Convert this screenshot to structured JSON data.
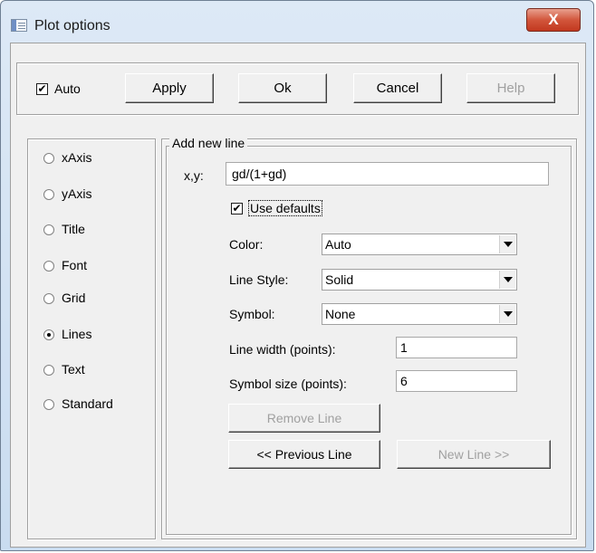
{
  "window": {
    "title": "Plot options",
    "close_glyph": "X"
  },
  "toolbar": {
    "auto_label": "Auto",
    "auto_checked": true,
    "apply_label": "Apply",
    "ok_label": "Ok",
    "cancel_label": "Cancel",
    "help_label": "Help"
  },
  "categories": {
    "items": [
      {
        "label": "xAxis",
        "selected": false
      },
      {
        "label": "yAxis",
        "selected": false
      },
      {
        "label": "Title",
        "selected": false
      },
      {
        "label": "Font",
        "selected": false
      },
      {
        "label": "Grid",
        "selected": false
      },
      {
        "label": "Lines",
        "selected": true
      },
      {
        "label": "Text",
        "selected": false
      },
      {
        "label": "Standard",
        "selected": false
      }
    ]
  },
  "line_panel": {
    "group_title": "Add new line",
    "xy_label": "x,y:",
    "xy_value": "gd/(1+gd)",
    "use_defaults_label": "Use defaults",
    "use_defaults_checked": true,
    "color_label": "Color:",
    "color_value": "Auto",
    "line_style_label": "Line Style:",
    "line_style_value": "Solid",
    "symbol_label": "Symbol:",
    "symbol_value": "None",
    "line_width_label": "Line width (points):",
    "line_width_value": "1",
    "symbol_size_label": "Symbol size (points):",
    "symbol_size_value": "6",
    "remove_line_label": "Remove Line",
    "previous_line_label": "<< Previous Line",
    "new_line_label": "New Line >>"
  },
  "colors": {
    "close_button": "#c2381f",
    "dialog_face": "#f0f0f0",
    "disabled_text": "#a0a0a0"
  }
}
